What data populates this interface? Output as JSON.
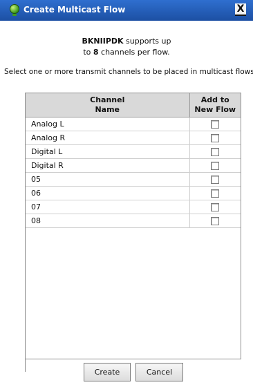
{
  "window": {
    "title": "Create Multicast Flow",
    "close_glyph": "X"
  },
  "support": {
    "device": "BKNIIPDK",
    "line1_suffix": "supports up",
    "line2_prefix": "to",
    "channels": "8",
    "line2_suffix": "channels per flow."
  },
  "instruction": "Select one or more transmit channels to be placed in multicast flows.",
  "table": {
    "headers": {
      "channel_line1": "Channel",
      "channel_line2": "Name",
      "add_line1": "Add to",
      "add_line2": "New Flow"
    },
    "rows": [
      {
        "name": "Analog L",
        "checked": false
      },
      {
        "name": "Analog R",
        "checked": false
      },
      {
        "name": "Digital L",
        "checked": false
      },
      {
        "name": "Digital R",
        "checked": false
      },
      {
        "name": "05",
        "checked": false
      },
      {
        "name": "06",
        "checked": false
      },
      {
        "name": "07",
        "checked": false
      },
      {
        "name": "08",
        "checked": false
      }
    ]
  },
  "buttons": {
    "create": "Create",
    "cancel": "Cancel"
  }
}
